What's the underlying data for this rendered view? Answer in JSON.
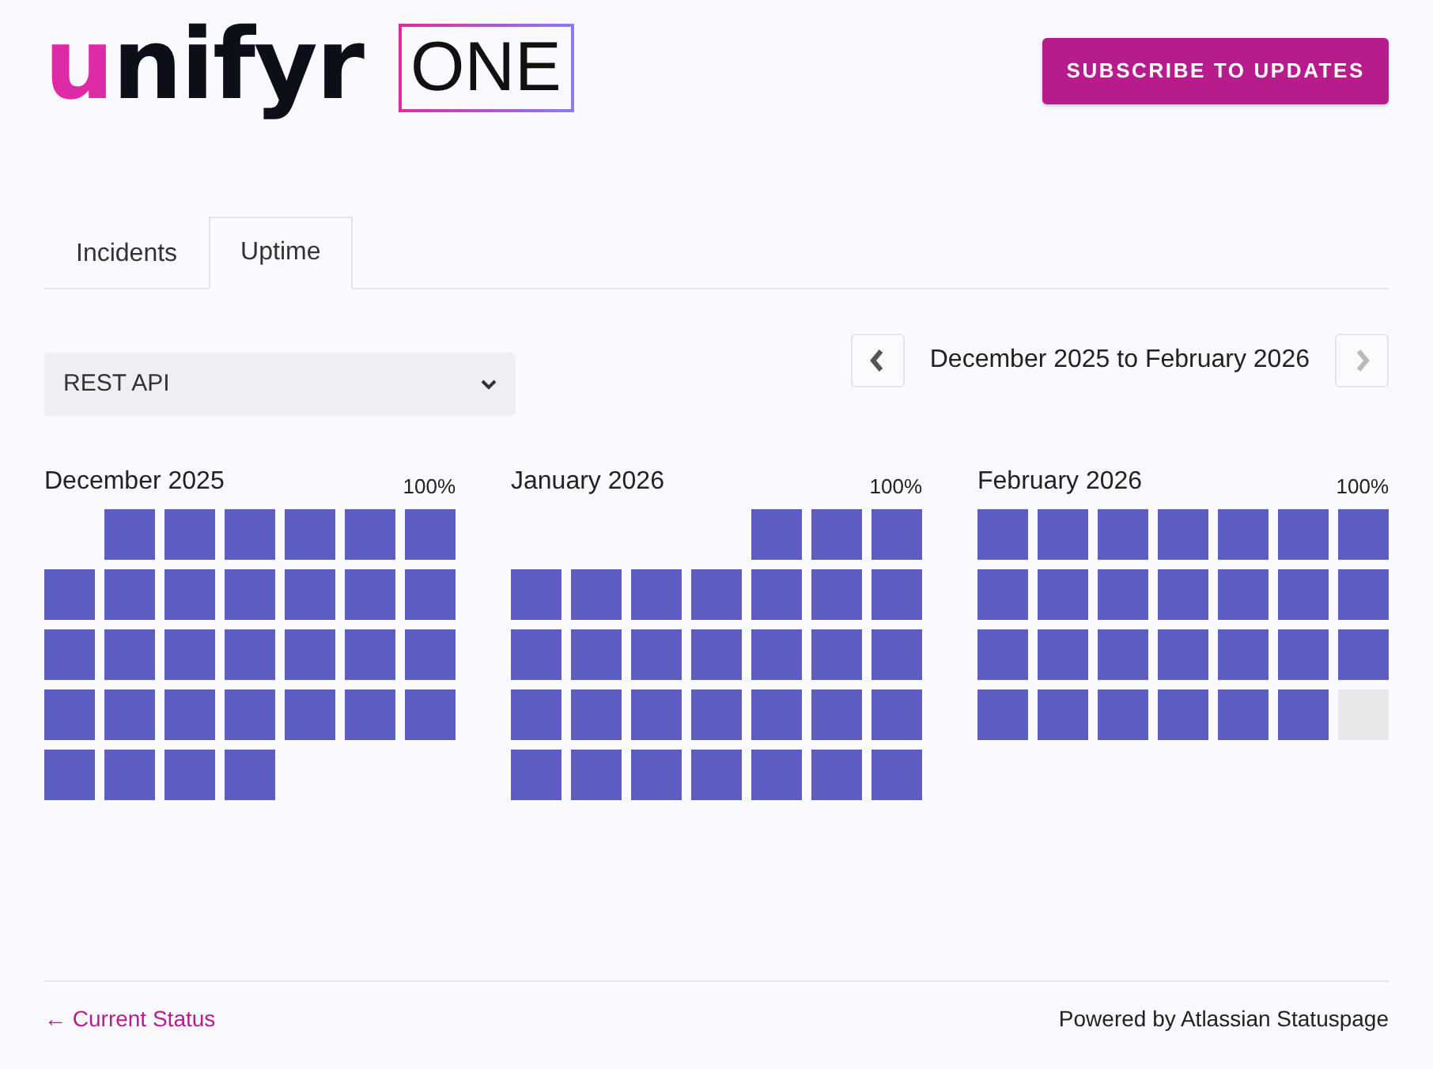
{
  "header": {
    "logo_text": "unifyr",
    "logo_badge": "ONE",
    "subscribe_button": "SUBSCRIBE TO UPDATES"
  },
  "tabs": [
    {
      "label": "Incidents",
      "selected": false
    },
    {
      "label": "Uptime",
      "selected": true
    }
  ],
  "component_select": {
    "value": "REST API"
  },
  "range": {
    "label": "December 2025 to February 2026",
    "prev_disabled": false,
    "next_disabled": true
  },
  "months": [
    {
      "name": "December 2025",
      "uptime": "100%",
      "days": [
        {
          "kind": "blank"
        },
        {
          "kind": "up"
        },
        {
          "kind": "up"
        },
        {
          "kind": "up"
        },
        {
          "kind": "up"
        },
        {
          "kind": "up"
        },
        {
          "kind": "up"
        },
        {
          "kind": "up"
        },
        {
          "kind": "up"
        },
        {
          "kind": "up"
        },
        {
          "kind": "up"
        },
        {
          "kind": "up"
        },
        {
          "kind": "up"
        },
        {
          "kind": "up"
        },
        {
          "kind": "up"
        },
        {
          "kind": "up"
        },
        {
          "kind": "up"
        },
        {
          "kind": "up"
        },
        {
          "kind": "up"
        },
        {
          "kind": "up"
        },
        {
          "kind": "up"
        },
        {
          "kind": "up"
        },
        {
          "kind": "up"
        },
        {
          "kind": "up"
        },
        {
          "kind": "up"
        },
        {
          "kind": "up"
        },
        {
          "kind": "up"
        },
        {
          "kind": "up"
        },
        {
          "kind": "up"
        },
        {
          "kind": "up"
        },
        {
          "kind": "up"
        },
        {
          "kind": "up"
        }
      ]
    },
    {
      "name": "January 2026",
      "uptime": "100%",
      "days": [
        {
          "kind": "blank"
        },
        {
          "kind": "blank"
        },
        {
          "kind": "blank"
        },
        {
          "kind": "blank"
        },
        {
          "kind": "up"
        },
        {
          "kind": "up"
        },
        {
          "kind": "up"
        },
        {
          "kind": "up"
        },
        {
          "kind": "up"
        },
        {
          "kind": "up"
        },
        {
          "kind": "up"
        },
        {
          "kind": "up"
        },
        {
          "kind": "up"
        },
        {
          "kind": "up"
        },
        {
          "kind": "up"
        },
        {
          "kind": "up"
        },
        {
          "kind": "up"
        },
        {
          "kind": "up"
        },
        {
          "kind": "up"
        },
        {
          "kind": "up"
        },
        {
          "kind": "up"
        },
        {
          "kind": "up"
        },
        {
          "kind": "up"
        },
        {
          "kind": "up"
        },
        {
          "kind": "up"
        },
        {
          "kind": "up"
        },
        {
          "kind": "up"
        },
        {
          "kind": "up"
        },
        {
          "kind": "up"
        },
        {
          "kind": "up"
        },
        {
          "kind": "up"
        },
        {
          "kind": "up"
        },
        {
          "kind": "up"
        },
        {
          "kind": "up"
        },
        {
          "kind": "up"
        }
      ]
    },
    {
      "name": "February 2026",
      "uptime": "100%",
      "days": [
        {
          "kind": "up"
        },
        {
          "kind": "up"
        },
        {
          "kind": "up"
        },
        {
          "kind": "up"
        },
        {
          "kind": "up"
        },
        {
          "kind": "up"
        },
        {
          "kind": "up"
        },
        {
          "kind": "up"
        },
        {
          "kind": "up"
        },
        {
          "kind": "up"
        },
        {
          "kind": "up"
        },
        {
          "kind": "up"
        },
        {
          "kind": "up"
        },
        {
          "kind": "up"
        },
        {
          "kind": "up"
        },
        {
          "kind": "up"
        },
        {
          "kind": "up"
        },
        {
          "kind": "up"
        },
        {
          "kind": "up"
        },
        {
          "kind": "up"
        },
        {
          "kind": "up"
        },
        {
          "kind": "up"
        },
        {
          "kind": "up"
        },
        {
          "kind": "up"
        },
        {
          "kind": "up"
        },
        {
          "kind": "up"
        },
        {
          "kind": "up"
        },
        {
          "kind": "nodata"
        }
      ]
    }
  ],
  "footer": {
    "back_link": "← Current Status",
    "powered_by": "Powered by Atlassian Statuspage"
  }
}
